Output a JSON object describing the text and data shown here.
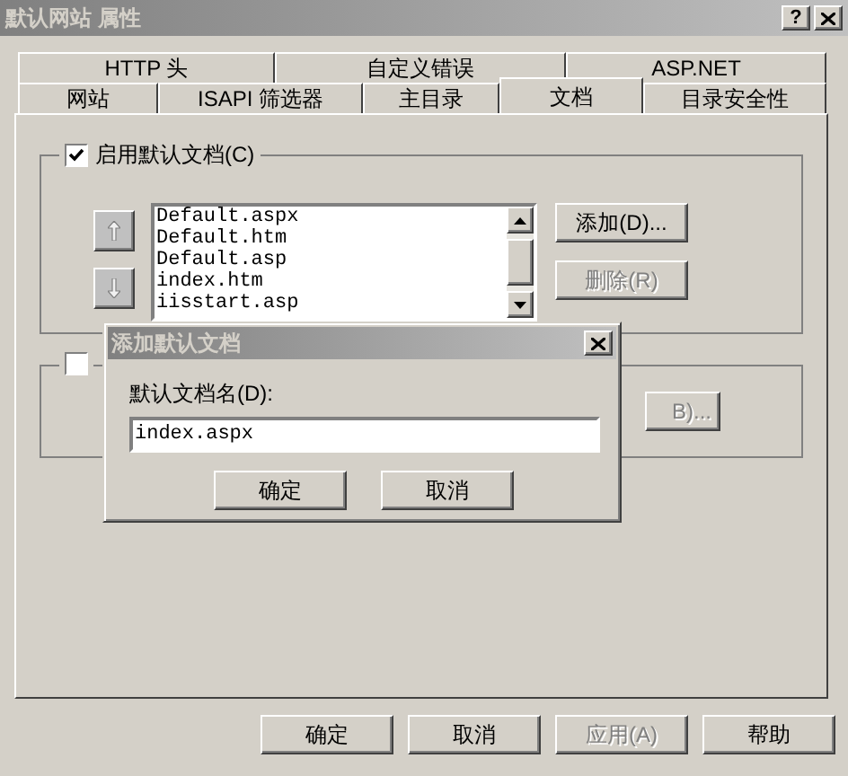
{
  "window": {
    "title": "默认网站 属性",
    "help": "?"
  },
  "tab_rows": [
    [
      {
        "label": "HTTP 头",
        "selected": false
      },
      {
        "label": "自定义错误",
        "selected": false
      },
      {
        "label": "ASP.NET",
        "selected": false
      }
    ],
    [
      {
        "label": "网站",
        "selected": false
      },
      {
        "label": "ISAPI 筛选器",
        "selected": false
      },
      {
        "label": "主目录",
        "selected": false
      },
      {
        "label": "文档",
        "selected": true
      },
      {
        "label": "目录安全性",
        "selected": false
      }
    ]
  ],
  "default_documents": {
    "checkbox": {
      "label": "启用默认文档(C)",
      "checked": true
    },
    "documents": [
      "Default.aspx",
      "Default.htm",
      "Default.asp",
      "index.htm",
      "iisstart.asp"
    ],
    "add_button": {
      "label": "添加(D)...",
      "disabled": false
    },
    "remove_button": {
      "label": "删除(R)",
      "disabled": true
    }
  },
  "footer_group": {
    "checked": false,
    "button": {
      "label": "B)...",
      "disabled": true
    }
  },
  "dialog": {
    "title": "添加默认文档",
    "field_label": "默认文档名(D):",
    "value": "index.aspx",
    "buttons": [
      {
        "label": "确定",
        "disabled": false
      },
      {
        "label": "取消",
        "disabled": false
      }
    ]
  },
  "buttons": [
    {
      "label": "确定",
      "disabled": false
    },
    {
      "label": "取消",
      "disabled": false
    },
    {
      "label": "应用(A)",
      "disabled": true
    },
    {
      "label": "帮助",
      "disabled": false
    }
  ]
}
